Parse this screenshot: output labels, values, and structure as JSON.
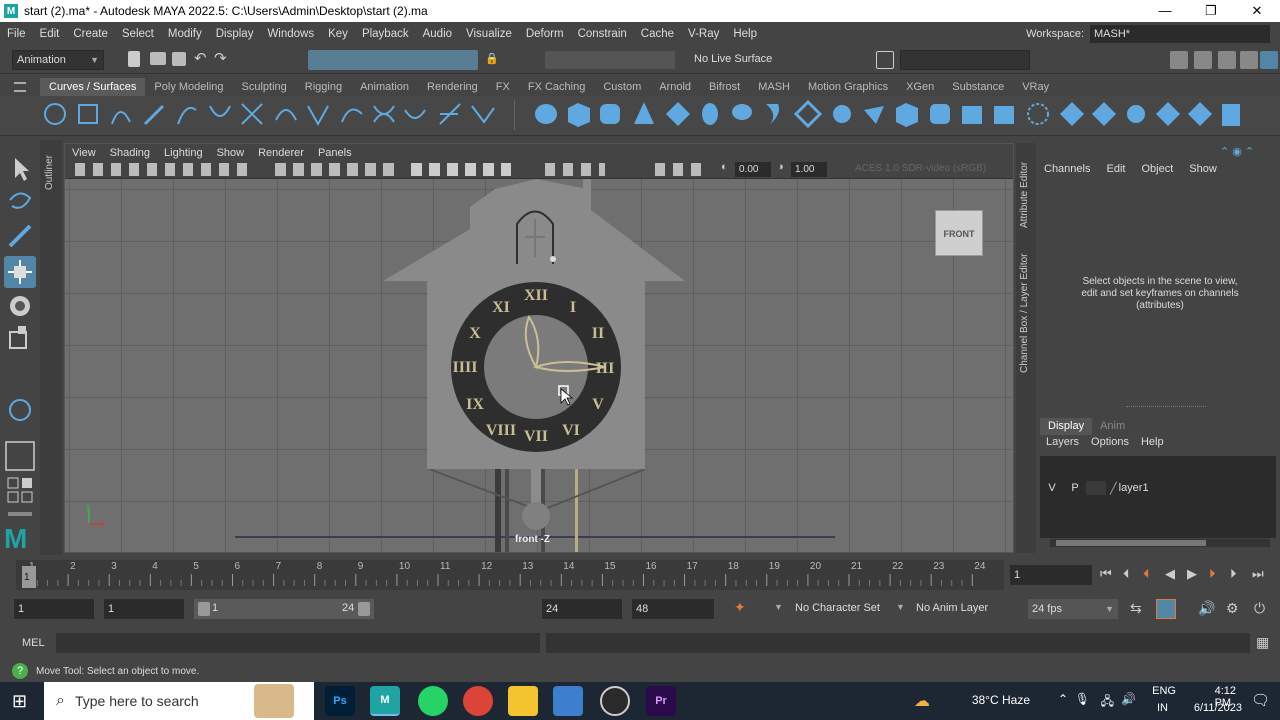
{
  "window": {
    "title": "start (2).ma* - Autodesk MAYA 2022.5: C:\\Users\\Admin\\Desktop\\start (2).ma",
    "app_icon": "M",
    "minimize": "—",
    "maximize": "❐",
    "close": "✕"
  },
  "menubar": [
    "File",
    "Edit",
    "Create",
    "Select",
    "Modify",
    "Display",
    "Windows",
    "Key",
    "Playback",
    "Audio",
    "Visualize",
    "Deform",
    "Constrain",
    "Cache",
    "V-Ray",
    "Help"
  ],
  "workspace": {
    "label": "Workspace:",
    "value": "MASH*"
  },
  "statusline": {
    "menuset": "Animation",
    "live_surface": "No Live Surface"
  },
  "shelf": {
    "tabs": [
      "Curves / Surfaces",
      "Poly Modeling",
      "Sculpting",
      "Rigging",
      "Animation",
      "Rendering",
      "FX",
      "FX Caching",
      "Custom",
      "Arnold",
      "Bifrost",
      "MASH",
      "Motion Graphics",
      "XGen",
      "Substance",
      "VRay"
    ],
    "active_tab": "Curves / Surfaces"
  },
  "outliner_label": "Outliner",
  "viewport": {
    "menu": [
      "View",
      "Shading",
      "Lighting",
      "Show",
      "Renderer",
      "Panels"
    ],
    "exposure": "0.00",
    "gamma": "1.00",
    "colorspace": "ACES 1.0 SDR-video (sRGB)",
    "viewcube": "FRONT",
    "camera": "front -Z",
    "clock_numerals": [
      "XII",
      "I",
      "II",
      "III",
      "IIII",
      "V",
      "VI",
      "VII",
      "VIII",
      "IX",
      "X",
      "XI"
    ]
  },
  "side_tabs": [
    "Attribute Editor",
    "Channel Box / Layer Editor"
  ],
  "channelbox": {
    "menu": [
      "Channels",
      "Edit",
      "Object",
      "Show"
    ],
    "message_line1": "Select objects in the scene to view,",
    "message_line2": "edit and set keyframes on channels",
    "message_line3": "(attributes)"
  },
  "layereditor": {
    "tabs": [
      "Display",
      "Anim"
    ],
    "menu": [
      "Layers",
      "Options",
      "Help"
    ],
    "layer": {
      "v": "V",
      "p": "P",
      "name": "layer1"
    }
  },
  "timeslider": {
    "ticks": [
      "1",
      "2",
      "3",
      "4",
      "5",
      "6",
      "7",
      "8",
      "9",
      "10",
      "11",
      "12",
      "13",
      "14",
      "15",
      "16",
      "17",
      "18",
      "19",
      "20",
      "21",
      "22",
      "23",
      "24"
    ],
    "current_frame": "1"
  },
  "rangeslider": {
    "start": "1",
    "start2": "1",
    "range_start": "1",
    "range_end": "24",
    "end": "24",
    "end2": "48",
    "character_set": "No Character Set",
    "anim_layer": "No Anim Layer",
    "fps": "24 fps"
  },
  "cmdline": {
    "label": "MEL"
  },
  "helpline": "Move Tool: Select an object to move.",
  "taskbar": {
    "search_placeholder": "Type here to search",
    "weather": "38°C  Haze",
    "lang": "ENG",
    "region": "IN",
    "time": "4:12 PM",
    "date": "6/11/2023",
    "apps": [
      "Ps",
      "M",
      "",
      "",
      "",
      "",
      "Pr"
    ]
  },
  "colors": {
    "maya_teal": "#1fa3a3",
    "accent_blue": "#5fa9e0",
    "highlight": "#5285a6"
  }
}
